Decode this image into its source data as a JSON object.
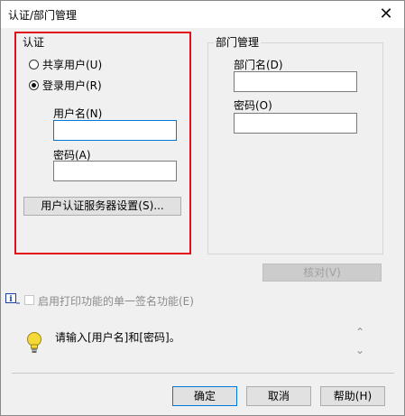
{
  "window": {
    "title": "认证/部门管理",
    "close_glyph": "✕"
  },
  "auth": {
    "group_label": "认证",
    "shared_user": "共享用户(U)",
    "login_user": "登录用户(R)",
    "username_label": "用户名(N)",
    "password_label": "密码(A)",
    "username_value": "",
    "password_value": "",
    "server_settings_button": "用户认证服务器设置(S)..."
  },
  "dept": {
    "group_label": "部门管理",
    "dept_name_label": "部门名(D)",
    "password_label": "密码(O)",
    "dept_name_value": "",
    "password_value": "",
    "verify_button": "核对(V)"
  },
  "print_option": {
    "label": "启用打印功能的单一签名功能(E)",
    "info_glyph": "i"
  },
  "message": {
    "text": "请输入[用户名]和[密码]。",
    "scroll_up": "⌃",
    "scroll_down": "⌄"
  },
  "footer": {
    "ok": "确定",
    "cancel": "取消",
    "help": "帮助(H)"
  },
  "colors": {
    "highlight_border": "#e2101a",
    "focus_border": "#0078d7",
    "bulb": "#f5d938"
  }
}
